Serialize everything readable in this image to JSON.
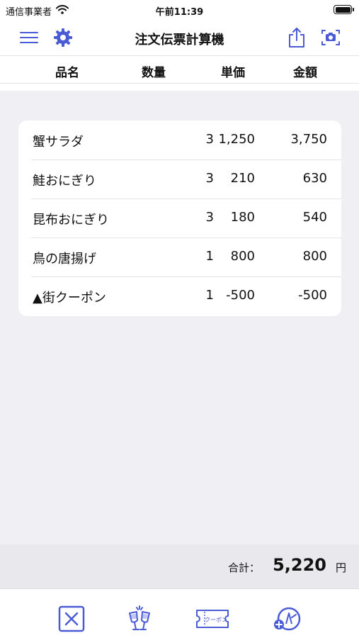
{
  "status": {
    "carrier": "通信事業者",
    "time": "午前11:39"
  },
  "nav": {
    "title": "注文伝票計算機"
  },
  "columns": {
    "name": "品名",
    "qty": "数量",
    "price": "単価",
    "amount": "金額"
  },
  "items": [
    {
      "name": "蟹サラダ",
      "qty": "3",
      "price": "1,250",
      "amount": "3,750"
    },
    {
      "name": "鮭おにぎり",
      "qty": "3",
      "price": "210",
      "amount": "630"
    },
    {
      "name": "昆布おにぎり",
      "qty": "3",
      "price": "180",
      "amount": "540"
    },
    {
      "name": "鳥の唐揚げ",
      "qty": "1",
      "price": "800",
      "amount": "800"
    },
    {
      "name": "▲街クーポン",
      "qty": "1",
      "price": "-500",
      "amount": "-500"
    }
  ],
  "total": {
    "label": "合計：",
    "value": "5,220",
    "unit": "円"
  },
  "toolbar": {
    "coupon_text": "クーポン"
  },
  "colors": {
    "accent": "#4a5bd6",
    "background": "#efeff4"
  },
  "icons": {
    "status": [
      "wifi-icon",
      "battery-icon"
    ],
    "nav": [
      "menu-icon",
      "gear-icon",
      "share-icon",
      "camera-icon"
    ],
    "toolbar": [
      "clear-icon",
      "toast-icon",
      "coupon-icon",
      "add-item-icon"
    ]
  }
}
